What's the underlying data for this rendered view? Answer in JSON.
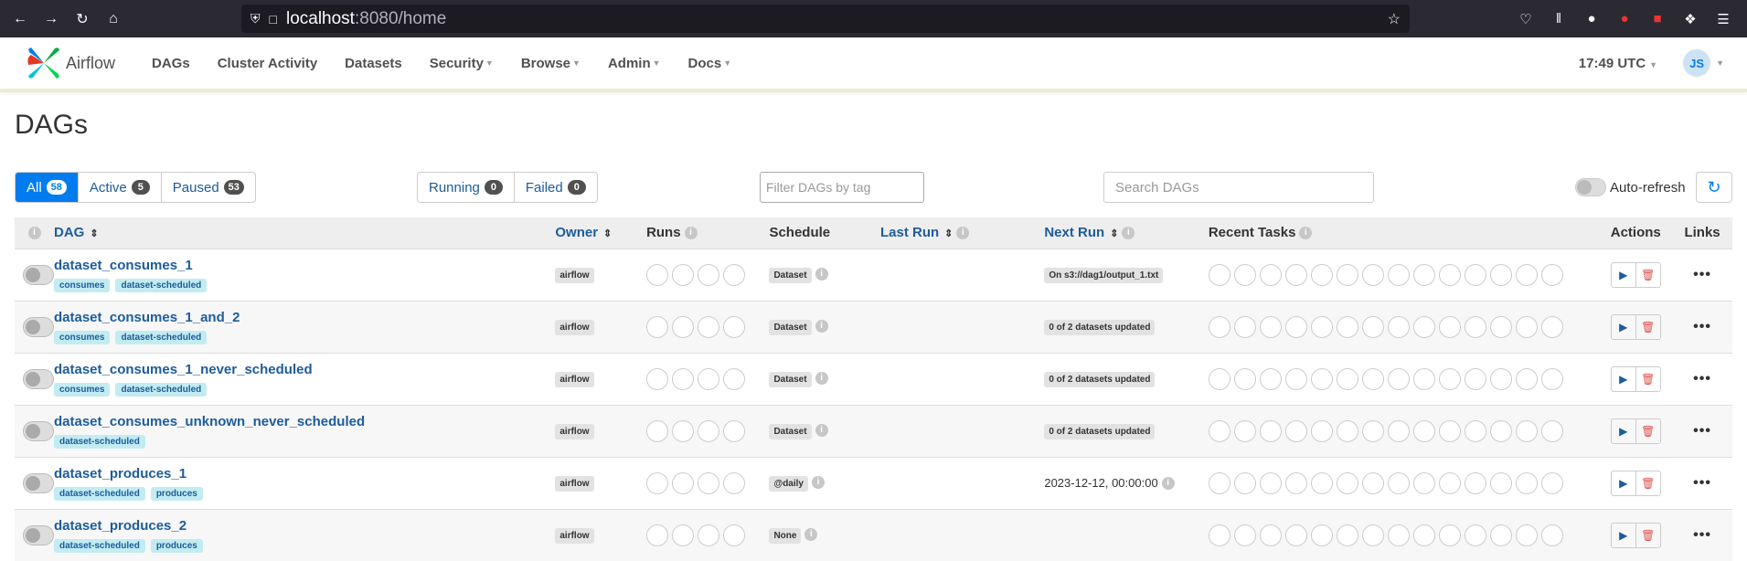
{
  "browser": {
    "url_host": "localhost",
    "url_path": ":8080/home"
  },
  "nav": {
    "brand": "Airflow",
    "items": [
      {
        "label": "DAGs",
        "dropdown": false
      },
      {
        "label": "Cluster Activity",
        "dropdown": false
      },
      {
        "label": "Datasets",
        "dropdown": false
      },
      {
        "label": "Security",
        "dropdown": true
      },
      {
        "label": "Browse",
        "dropdown": true
      },
      {
        "label": "Admin",
        "dropdown": true
      },
      {
        "label": "Docs",
        "dropdown": true
      }
    ],
    "clock": "17:49 UTC",
    "avatar_initials": "JS"
  },
  "page_title": "DAGs",
  "status_filter": [
    {
      "label": "All",
      "count": "58",
      "active": true
    },
    {
      "label": "Active",
      "count": "5",
      "active": false
    },
    {
      "label": "Paused",
      "count": "53",
      "active": false
    }
  ],
  "run_filter": [
    {
      "label": "Running",
      "count": "0"
    },
    {
      "label": "Failed",
      "count": "0"
    }
  ],
  "tag_filter_placeholder": "Filter DAGs by tag",
  "search_placeholder": "Search DAGs",
  "auto_refresh_label": "Auto-refresh",
  "columns": {
    "dag": "DAG",
    "owner": "Owner",
    "runs": "Runs",
    "schedule": "Schedule",
    "last_run": "Last Run",
    "next_run": "Next Run",
    "recent_tasks": "Recent Tasks",
    "actions": "Actions",
    "links": "Links"
  },
  "rows": [
    {
      "name": "dataset_consumes_1",
      "tags": [
        "consumes",
        "dataset-scheduled"
      ],
      "owner": "airflow",
      "schedule": "Dataset",
      "schedule_info": true,
      "next_run": "On s3://dag1/output_1.txt",
      "next_run_style": "label"
    },
    {
      "name": "dataset_consumes_1_and_2",
      "tags": [
        "consumes",
        "dataset-scheduled"
      ],
      "owner": "airflow",
      "schedule": "Dataset",
      "schedule_info": true,
      "next_run": "0 of 2 datasets updated",
      "next_run_style": "label"
    },
    {
      "name": "dataset_consumes_1_never_scheduled",
      "tags": [
        "consumes",
        "dataset-scheduled"
      ],
      "owner": "airflow",
      "schedule": "Dataset",
      "schedule_info": true,
      "next_run": "0 of 2 datasets updated",
      "next_run_style": "label"
    },
    {
      "name": "dataset_consumes_unknown_never_scheduled",
      "tags": [
        "dataset-scheduled"
      ],
      "owner": "airflow",
      "schedule": "Dataset",
      "schedule_info": true,
      "next_run": "0 of 2 datasets updated",
      "next_run_style": "label"
    },
    {
      "name": "dataset_produces_1",
      "tags": [
        "dataset-scheduled",
        "produces"
      ],
      "owner": "airflow",
      "schedule": "@daily",
      "schedule_info": true,
      "next_run": "2023-12-12, 00:00:00",
      "next_run_style": "text"
    },
    {
      "name": "dataset_produces_2",
      "tags": [
        "dataset-scheduled",
        "produces"
      ],
      "owner": "airflow",
      "schedule": "None",
      "schedule_info": true,
      "next_run": "",
      "next_run_style": "text"
    }
  ],
  "runs_circle_count": 4,
  "recent_tasks_circle_count": 14,
  "colors": {
    "brand_blue": "#017cee",
    "link_blue": "#1d5c9b",
    "tag_bg": "#c2ecf1",
    "delete_red": "#d9534f"
  }
}
